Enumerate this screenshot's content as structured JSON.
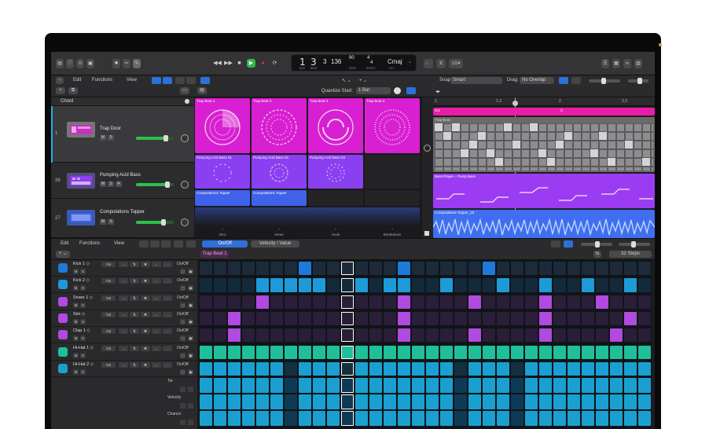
{
  "control_bar": {
    "lcd": {
      "bar": "1",
      "beat": "3",
      "div": "3",
      "tempo": "136",
      "keep": "90",
      "sig_top": "4",
      "sig_bottom": "4",
      "key": "Cmaj",
      "bar_label": "BAR",
      "beat_label": "BEAT",
      "tempo_label": "KEEP",
      "sig_label": "TEMPO",
      "key_label": "KEY"
    },
    "count_label": "1234"
  },
  "tracks_header": {
    "menus": [
      "Edit",
      "Functions",
      "View"
    ],
    "quantize_label": "Quantize Start:",
    "quantize_value": "1 Bar",
    "snap_label": "Snap:",
    "snap_value": "Smart",
    "drag_label": "Drag:",
    "drag_value": "No Overlap",
    "chord_label": "Chord"
  },
  "tracks": [
    {
      "num": "1",
      "name": "Trap Door",
      "mute": "M",
      "solo": "S",
      "color": "#d81fd1",
      "level": 0.78
    },
    {
      "num": "26",
      "name": "Pumping Acid Bass",
      "mute": "M",
      "solo": "S",
      "rec": "R",
      "color": "#8a3ff0",
      "level": 0.82
    },
    {
      "num": "27",
      "name": "Computations Topper",
      "mute": "M",
      "solo": "S",
      "color": "#3f62e8",
      "level": 0.72
    }
  ],
  "cells": {
    "row1": [
      "Trap Beat 1",
      "Trap Beat 2",
      "Trap Beat 3",
      "Trap Beat 4"
    ],
    "row2": [
      "Pumping Acid Bass 01",
      "Pumping Acid Bass 02",
      "Pumping Acid Bass 03"
    ],
    "row3": [
      "Computations Topper",
      "Computations Topper"
    ],
    "scenes": [
      "Intro",
      "Verse",
      "Hook",
      "Breakdown"
    ]
  },
  "arrangement": {
    "ruler": [
      "1",
      "1.3",
      "2",
      "2.3"
    ],
    "chord_region": "Gm",
    "chord_region_2": "C",
    "drum_region": "Trap Beat",
    "bass_region": "Bass Player – Pump Bass",
    "audio_region": "Computations Topper_03"
  },
  "sequencer": {
    "menus": [
      "Edit",
      "Functions",
      "View"
    ],
    "mode_on": "On/Off",
    "mode_value": "Velocity / Value",
    "pattern_name": "Trap Beat 1",
    "steps": "32 Steps",
    "rate": "/16",
    "onoff": "On/Off",
    "rows": [
      {
        "name": "Kick 1",
        "color": "#1e7ad8"
      },
      {
        "name": "Kick 2",
        "color": "#1e9ad8"
      },
      {
        "name": "Snare 1",
        "color": "#b14ae0"
      },
      {
        "name": "Sim",
        "color": "#b14ae0"
      },
      {
        "name": "Clap 1",
        "color": "#b14ae0"
      },
      {
        "name": "Hi-Hat 1",
        "color": "#1fbf9a"
      },
      {
        "name": "Hi-Hat 2",
        "color": "#1aa0d0"
      }
    ],
    "subrows": [
      "Tie",
      "Velocity",
      "Chance"
    ],
    "m": "M",
    "s": "S"
  }
}
